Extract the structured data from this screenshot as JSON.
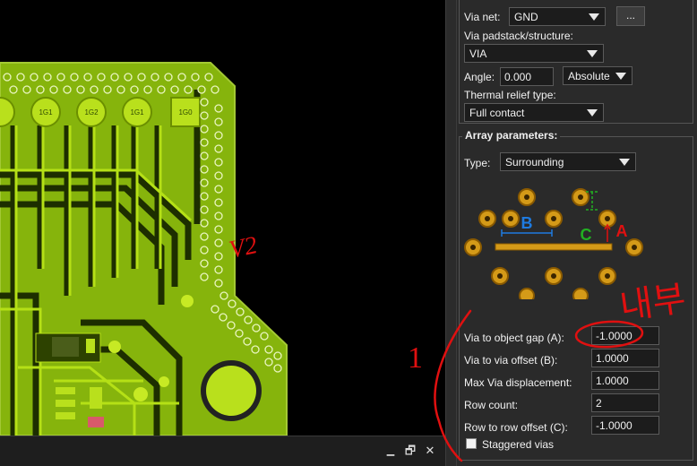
{
  "panel": {
    "via_net": {
      "label": "Via net:",
      "value": "GND",
      "more_button": "..."
    },
    "via_padstack": {
      "label": "Via padstack/structure:",
      "value": "VIA"
    },
    "angle": {
      "label": "Angle:",
      "value": "0.000",
      "mode": "Absolute"
    },
    "thermal_relief": {
      "label": "Thermal relief type:",
      "value": "Full contact"
    },
    "array_parameters": {
      "title": "Array parameters:",
      "type_label": "Type:",
      "type_value": "Surrounding",
      "diagram_labels": {
        "a": "A",
        "b": "B",
        "c": "C"
      },
      "fields": [
        {
          "label": "Via to object gap (A):",
          "value": "-1.0000"
        },
        {
          "label": "Via to via offset (B):",
          "value": "1.0000"
        },
        {
          "label": "Max Via displacement:",
          "value": "1.0000"
        },
        {
          "label": "Row count:",
          "value": "2"
        },
        {
          "label": "Row to row offset (C):",
          "value": "-1.0000"
        }
      ],
      "staggered": {
        "label": "Staggered vias",
        "checked": false
      }
    }
  },
  "pcb": {
    "pad_labels": [
      "1G1",
      "1G2",
      "1G1",
      "1G0"
    ]
  },
  "canvas_bar": {
    "restore_glyph": "🗗",
    "close_glyph": "✕"
  },
  "handwriting": {
    "note_top": "V2",
    "note_korean": "내부",
    "note_one": "1"
  },
  "colors": {
    "board": "#86b40c",
    "copper": "#a9d20f",
    "trace_dark": "#2f4a00",
    "panel_bg": "#2a2a2a",
    "annotation_red": "#e01010",
    "via_gold": "#d49a18"
  }
}
